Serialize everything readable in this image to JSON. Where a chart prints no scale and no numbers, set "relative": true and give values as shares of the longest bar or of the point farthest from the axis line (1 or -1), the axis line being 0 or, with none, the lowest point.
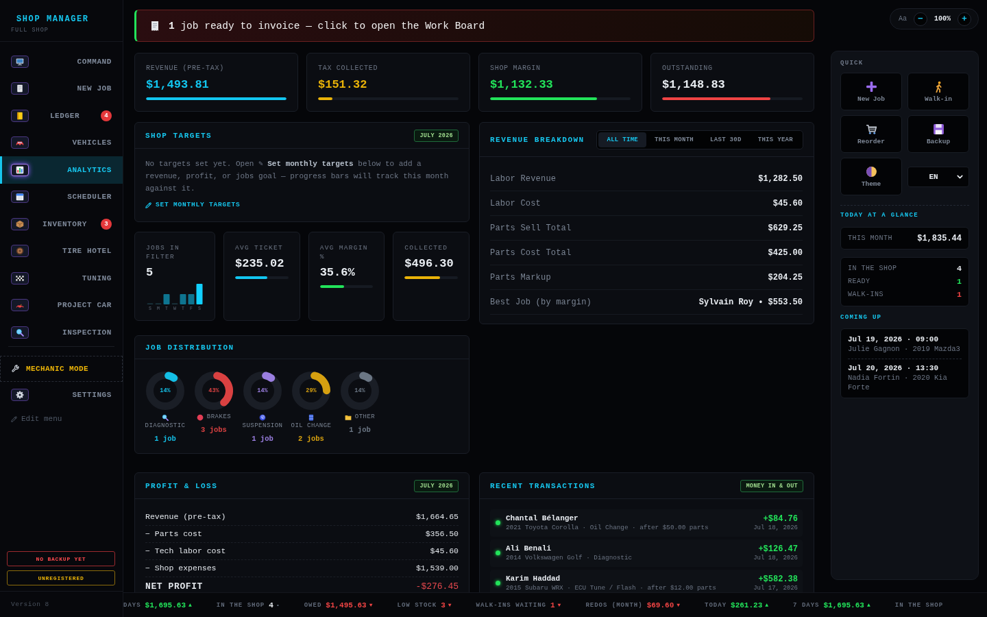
{
  "sidebar": {
    "brand": "SHOP MANAGER",
    "subtitle": "FULL SHOP",
    "items": [
      {
        "label": "COMMAND",
        "selected": false
      },
      {
        "label": "NEW JOB",
        "selected": false
      },
      {
        "label": "LEDGER",
        "badge": "4",
        "selected": false
      },
      {
        "label": "VEHICLES",
        "selected": false
      },
      {
        "label": "ANALYTICS",
        "selected": true
      },
      {
        "label": "SCHEDULER",
        "selected": false
      },
      {
        "label": "INVENTORY",
        "badge": "3",
        "selected": false
      },
      {
        "label": "TIRE HOTEL",
        "selected": false
      },
      {
        "label": "TUNING",
        "selected": false
      },
      {
        "label": "PROJECT CAR",
        "selected": false
      },
      {
        "label": "INSPECTION",
        "selected": false
      }
    ],
    "mechanic_mode": "MECHANIC MODE",
    "settings": {
      "label": "SETTINGS",
      "selected": false
    },
    "edit_menu": "Edit menu",
    "alerts": [
      {
        "label": "NO BACKUP YET",
        "kind": "danger"
      },
      {
        "label": "UNREGISTERED",
        "kind": "warning"
      }
    ],
    "version": "Version 8"
  },
  "banner": {
    "text": "**1** job ready to invoice — click to open the Work Board"
  },
  "kpis": [
    {
      "label": "REVENUE (PRE-TAX)",
      "value": "$1,493.81",
      "color": "#12c6f0",
      "value_tinted": true,
      "level": 1.0
    },
    {
      "label": "TAX COLLECTED",
      "value": "$151.32",
      "color": "#eab308",
      "value_tinted": true,
      "level": 0.1
    },
    {
      "label": "SHOP MARGIN",
      "value": "$1,132.33",
      "color": "#22e35a",
      "value_tinted": true,
      "level": 0.76
    },
    {
      "label": "OUTSTANDING",
      "value": "$1,148.83",
      "color": "#ef4444",
      "value_tinted": false,
      "level": 0.77
    }
  ],
  "shop_targets": {
    "title": "SHOP TARGETS",
    "badge": "JULY 2026",
    "message": "No targets set yet. Open ✎ **Set monthly targets** below to add a revenue, profit, or jobs goal — progress bars will track this month against it.",
    "link": "SET MONTHLY TARGETS"
  },
  "mini_stats": [
    {
      "kind": "chart",
      "label": "JOBS IN FILTER",
      "value": "5",
      "chart_data": {
        "type": "bar",
        "relative": true,
        "categories": [
          "S",
          "M",
          "T",
          "W",
          "T",
          "F",
          "S"
        ],
        "values": [
          0,
          0,
          0.5,
          0,
          0.5,
          0.5,
          1
        ]
      }
    },
    {
      "kind": "bar",
      "label": "AVG TICKET",
      "value": "$235.02",
      "color": "#12c6f0",
      "level": 0.61
    },
    {
      "kind": "bar",
      "label": "AVG MARGIN %",
      "value": "35.6%",
      "color": "#22e35a",
      "level": 0.46
    },
    {
      "kind": "bar",
      "label": "COLLECTED",
      "value": "$496.30",
      "color": "#eab308",
      "level": 0.66
    }
  ],
  "job_distribution": {
    "title": "JOB DISTRIBUTION",
    "items": [
      {
        "label": "DIAGNOSTIC",
        "percent": "14%",
        "level": 0.14,
        "count": "1 job",
        "color": "#14bfe6"
      },
      {
        "label": "BRAKES",
        "percent": "43%",
        "level": 0.43,
        "count": "3 jobs",
        "color": "#d94141"
      },
      {
        "label": "SUSPENSION",
        "percent": "14%",
        "level": 0.14,
        "count": "1 job",
        "color": "#9a7ee0"
      },
      {
        "label": "OIL CHANGE",
        "percent": "29%",
        "level": 0.29,
        "count": "2 jobs",
        "color": "#d6a010"
      },
      {
        "label": "OTHER",
        "percent": "14%",
        "level": 0.14,
        "count": "1 job",
        "color": "#6b7684"
      }
    ]
  },
  "revenue_breakdown": {
    "title": "REVENUE BREAKDOWN",
    "tabs": [
      {
        "label": "ALL TIME",
        "selected": true
      },
      {
        "label": "THIS MONTH",
        "selected": false
      },
      {
        "label": "LAST 30D",
        "selected": false
      },
      {
        "label": "THIS YEAR",
        "selected": false
      }
    ],
    "rows": [
      {
        "label": "Labor Revenue",
        "value": "$1,282.50"
      },
      {
        "label": "Labor Cost",
        "value": "$45.60"
      },
      {
        "label": "Parts Sell Total",
        "value": "$629.25"
      },
      {
        "label": "Parts Cost Total",
        "value": "$425.00"
      },
      {
        "label": "Parts Markup",
        "value": "$204.25"
      },
      {
        "label": "Best Job (by margin)",
        "value": "Sylvain Roy • $553.50"
      }
    ]
  },
  "profit_loss": {
    "title": "PROFIT & LOSS",
    "badge": "JULY 2026",
    "rows": [
      {
        "kind": "line",
        "label": "Revenue (pre-tax)",
        "value": "$1,664.65",
        "negative": false
      },
      {
        "kind": "line",
        "label": "− Parts cost",
        "value": "$356.50",
        "negative": false
      },
      {
        "kind": "line",
        "label": "− Tech labor cost",
        "value": "$45.60",
        "negative": false
      },
      {
        "kind": "line",
        "label": "− Shop expenses",
        "value": "$1,539.00",
        "negative": false
      },
      {
        "kind": "total",
        "label": "NET PROFIT",
        "value": "-$276.45",
        "negative": true
      }
    ]
  },
  "recent_transactions": {
    "title": "RECENT TRANSACTIONS",
    "badge": "MONEY IN & OUT",
    "items": [
      {
        "name": "Chantal Bélanger",
        "detail": "2021 Toyota Corolla · Oil Change · after $50.00 parts",
        "amount": "+$84.76",
        "date": "Jul 18, 2026",
        "incoming": true
      },
      {
        "name": "Ali Benali",
        "detail": "2014 Volkswagen Golf · Diagnostic",
        "amount": "+$126.47",
        "date": "Jul 18, 2026",
        "incoming": true
      },
      {
        "name": "Karim Haddad",
        "detail": "2015 Subaru WRX · ECU Tune / Flash · after $12.00 parts",
        "amount": "+$582.38",
        "date": "Jul 17, 2026",
        "incoming": true
      }
    ]
  },
  "font_size": {
    "label": "Aa",
    "decrease": "−",
    "value": "100%",
    "increase": "+"
  },
  "quick": {
    "title": "QUICK",
    "actions": [
      "New Job",
      "Walk-in",
      "Reorder",
      "Backup",
      "Theme"
    ],
    "language": "EN"
  },
  "today": {
    "title": "TODAY AT A GLANCE",
    "month_label": "THIS MONTH",
    "month_value": "$1,835.44",
    "stats": [
      {
        "label": "IN THE SHOP",
        "value": "4",
        "color": "#e9edf2"
      },
      {
        "label": "READY",
        "value": "1",
        "color": "#22e35a"
      },
      {
        "label": "WALK-INS",
        "value": "1",
        "color": "#ef4444"
      }
    ]
  },
  "coming_up": {
    "title": "COMING UP",
    "items": [
      {
        "when": "Jul 19, 2026 · 09:00",
        "detail": "Julie Gagnon · 2019 Mazda3"
      },
      {
        "when": "Jul 20, 2026 · 13:30",
        "detail": "Nadia Fortin · 2020 Kia Forte"
      }
    ]
  },
  "ticker": [
    {
      "label": "DAYS",
      "value": "$1,695.63",
      "arrow": "▲",
      "rising": true,
      "falling": false
    },
    {
      "label": "IN THE SHOP",
      "value": "4",
      "arrow": "•",
      "rising": false,
      "falling": false
    },
    {
      "label": "OWED",
      "value": "$1,495.63",
      "arrow": "▼",
      "rising": false,
      "falling": true
    },
    {
      "label": "LOW STOCK",
      "value": "3",
      "arrow": "▼",
      "rising": false,
      "falling": true
    },
    {
      "label": "WALK-INS WAITING",
      "value": "1",
      "arrow": "▼",
      "rising": false,
      "falling": true
    },
    {
      "label": "REDOS (MONTH)",
      "value": "$69.60",
      "arrow": "▼",
      "rising": false,
      "falling": true
    },
    {
      "label": "TODAY",
      "value": "$261.23",
      "arrow": "▲",
      "rising": true,
      "falling": false
    },
    {
      "label": "7 DAYS",
      "value": "$1,695.63",
      "arrow": "▲",
      "rising": true,
      "falling": false
    },
    {
      "label": "IN THE SHOP"
    }
  ]
}
